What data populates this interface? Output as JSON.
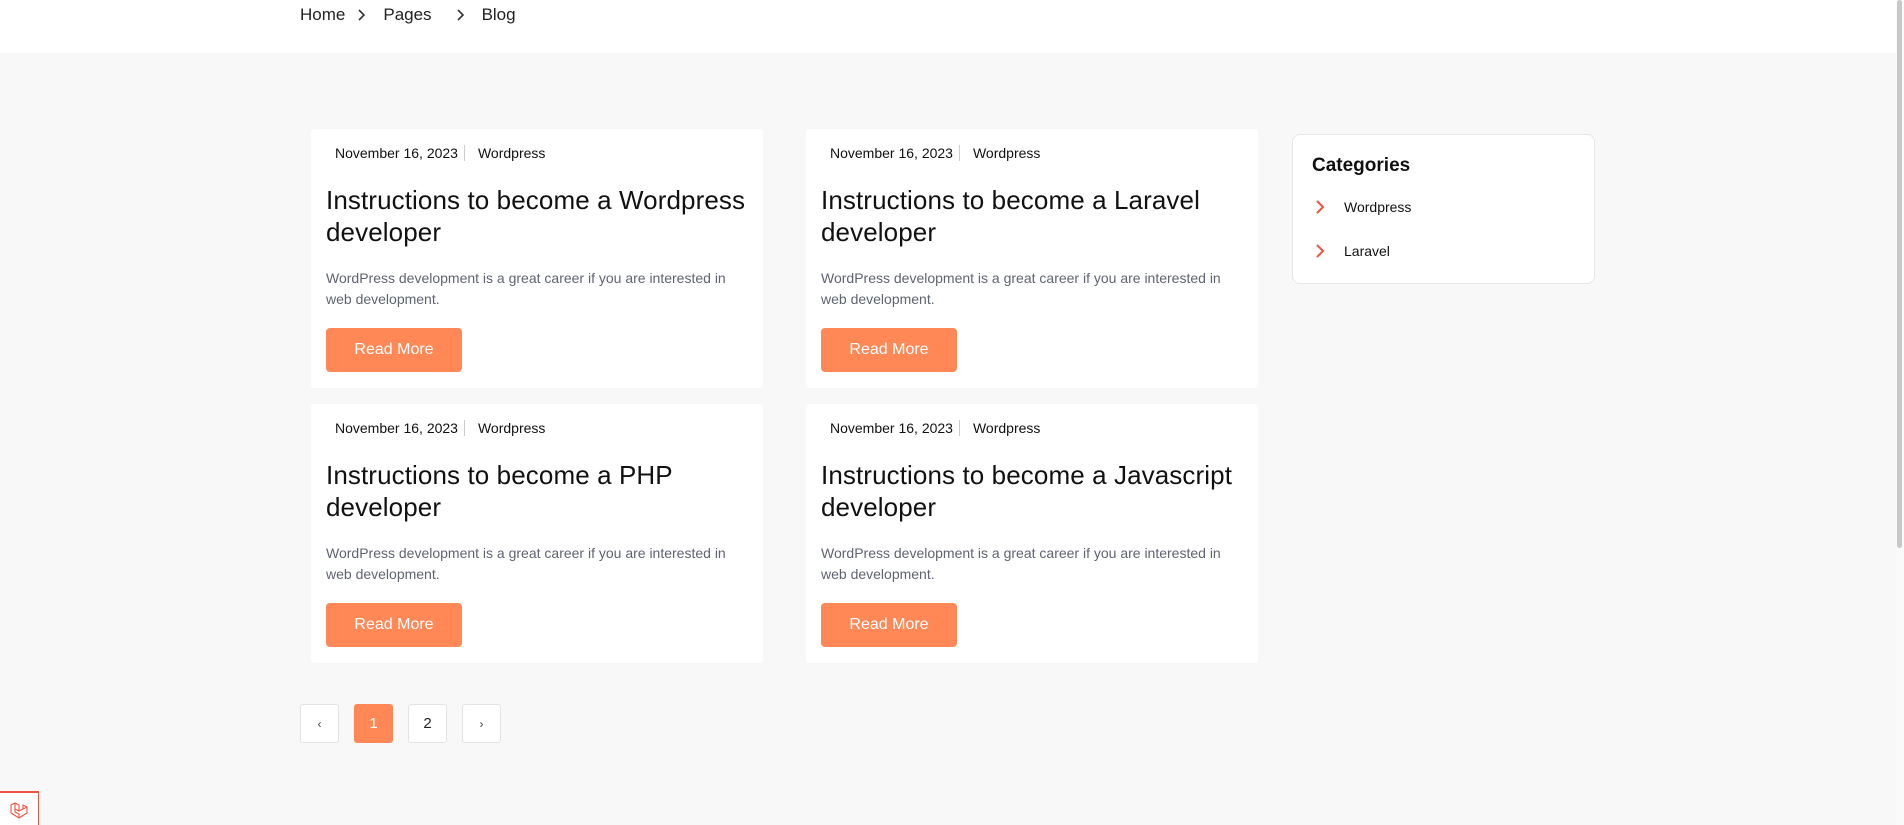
{
  "breadcrumb": {
    "items": [
      "Home",
      "Pages",
      "Blog"
    ]
  },
  "colors": {
    "accent": "#ff8856",
    "chevron": "#f05340",
    "background": "#f8f8f8"
  },
  "posts": [
    {
      "date": "November 16, 2023",
      "category": "Wordpress",
      "title": "Instructions to become a Wordpress developer",
      "excerpt": "WordPress development is a great career if you are interested in web development.",
      "button": "Read More"
    },
    {
      "date": "November 16, 2023",
      "category": "Wordpress",
      "title": "Instructions to become a Laravel developer",
      "excerpt": "WordPress development is a great career if you are interested in web development.",
      "button": "Read More"
    },
    {
      "date": "November 16, 2023",
      "category": "Wordpress",
      "title": "Instructions to become a PHP developer",
      "excerpt": "WordPress development is a great career if you are interested in web development.",
      "button": "Read More"
    },
    {
      "date": "November 16, 2023",
      "category": "Wordpress",
      "title": "Instructions to become a Javascript developer",
      "excerpt": "WordPress development is a great career if you are interested in web development.",
      "button": "Read More"
    }
  ],
  "sidebar": {
    "title": "Categories",
    "items": [
      {
        "label": "Wordpress",
        "icon": "chevron-right-icon"
      },
      {
        "label": "Laravel",
        "icon": "chevron-right-icon"
      }
    ]
  },
  "pagination": {
    "prev": "‹",
    "pages": [
      "1",
      "2"
    ],
    "current": "1",
    "next": "›"
  },
  "icons": {
    "breadcrumb_separator": "chevron-right-icon",
    "badge": "laravel-logo-icon"
  }
}
